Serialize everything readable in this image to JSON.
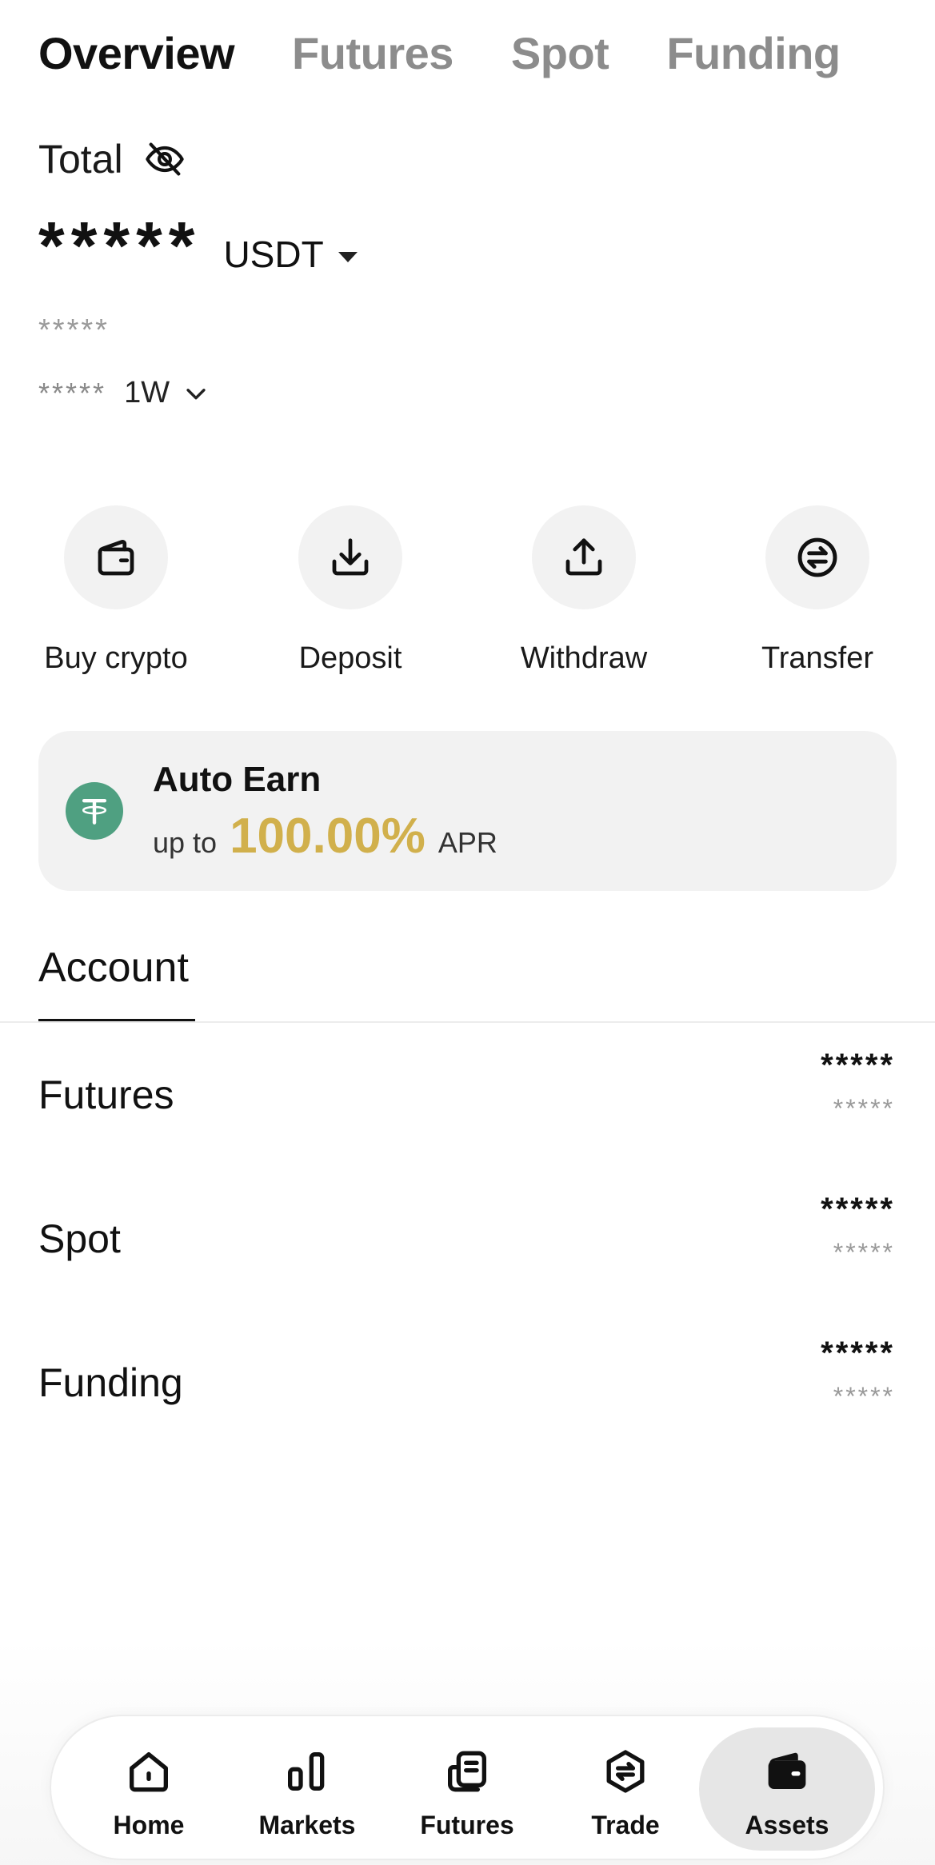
{
  "tabs": [
    {
      "label": "Overview",
      "active": true
    },
    {
      "label": "Futures",
      "active": false
    },
    {
      "label": "Spot",
      "active": false
    },
    {
      "label": "Funding",
      "active": false
    }
  ],
  "summary": {
    "total_label": "Total",
    "balance": "*****",
    "currency": "USDT",
    "sub_balance": "*****",
    "pnl": "*****",
    "period": "1W"
  },
  "actions": [
    {
      "label": "Buy crypto",
      "icon": "wallet-icon"
    },
    {
      "label": "Deposit",
      "icon": "download-icon"
    },
    {
      "label": "Withdraw",
      "icon": "upload-icon"
    },
    {
      "label": "Transfer",
      "icon": "transfer-icon"
    }
  ],
  "promo": {
    "title": "Auto Earn",
    "prefix": "up to",
    "rate": "100.00%",
    "suffix": "APR",
    "icon": "tether-icon",
    "accent_color": "#d1b04c"
  },
  "accounts": {
    "tab_label": "Account",
    "rows": [
      {
        "name": "Futures",
        "value": "*****",
        "sub": "*****"
      },
      {
        "name": "Spot",
        "value": "*****",
        "sub": "*****"
      },
      {
        "name": "Funding",
        "value": "*****",
        "sub": "*****"
      }
    ]
  },
  "bottom_nav": [
    {
      "label": "Home",
      "icon": "home-icon",
      "active": false
    },
    {
      "label": "Markets",
      "icon": "markets-icon",
      "active": false
    },
    {
      "label": "Futures",
      "icon": "futures-icon",
      "active": false
    },
    {
      "label": "Trade",
      "icon": "trade-icon",
      "active": false
    },
    {
      "label": "Assets",
      "icon": "assets-wallet-icon",
      "active": true
    }
  ]
}
